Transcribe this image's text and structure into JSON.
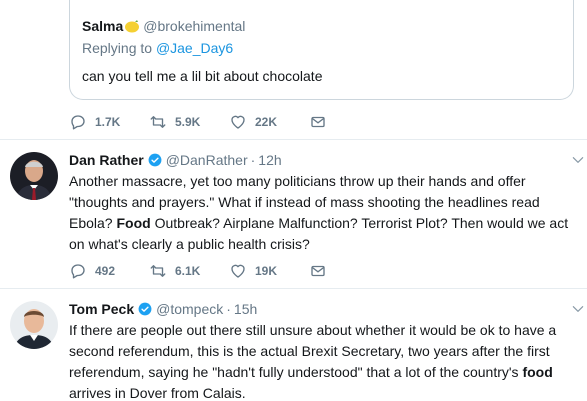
{
  "quoted_tweet": {
    "name": "Salma",
    "handle": "@brokehimental",
    "replying_prefix": "Replying to ",
    "replying_to": "@Jae_Day6",
    "text": "can you tell me a lil bit about chocolate",
    "stats": {
      "replies": "1.7K",
      "retweets": "5.9K",
      "likes": "22K"
    }
  },
  "tweets": [
    {
      "name": "Dan Rather",
      "handle": "@DanRather",
      "separator": "·",
      "time": "12h",
      "text_parts": [
        "Another massacre, yet too many politicians throw up their hands and offer \"thoughts and prayers.\" What if instead of mass shooting the headlines read Ebola? ",
        "Food",
        " Outbreak? Airplane Malfunction? Terrorist Plot? Then would we act on what's clearly a public health crisis?"
      ],
      "stats": {
        "replies": "492",
        "retweets": "6.1K",
        "likes": "19K"
      }
    },
    {
      "name": "Tom Peck",
      "handle": "@tompeck",
      "separator": "·",
      "time": "15h",
      "text_parts": [
        "If there are people out there still unsure about whether it would be ok to have a second referendum, this is the actual Brexit Secretary, two years after the first referendum, saying he \"hadn't fully understood\" that a lot of the country's ",
        "food",
        " arrives in Dover from Calais."
      ]
    }
  ],
  "colors": {
    "accent": "#1da1f2",
    "link": "#1b95e0",
    "muted": "#657786",
    "border": "#e6ecf0"
  }
}
